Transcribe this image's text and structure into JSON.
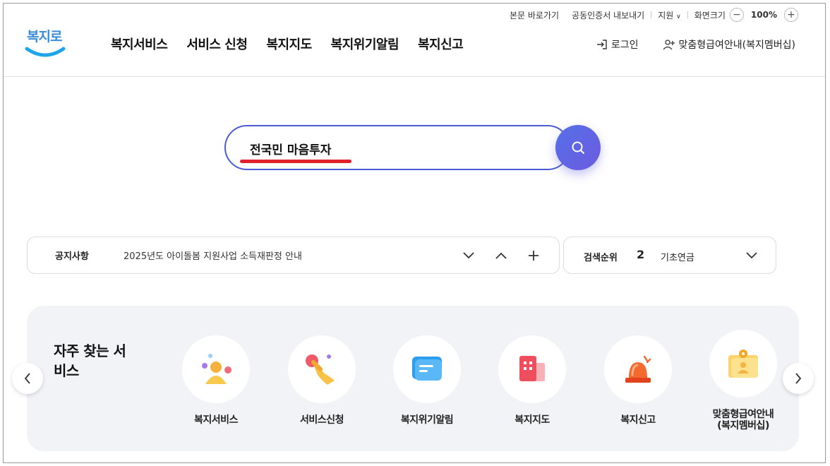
{
  "util": {
    "skip_to_content": "본문 바로가기",
    "cert_export": "공동인증서 내보내기",
    "support": "지원",
    "zoom_label": "화면크기",
    "zoom_value": "100%"
  },
  "header": {
    "logo_text": "복지로",
    "nav": [
      "복지서비스",
      "서비스 신청",
      "복지지도",
      "복지위기알림",
      "복지신고"
    ],
    "login": "로그인",
    "membership": "맞춤형급여안내(복지멤버십)"
  },
  "search": {
    "value": "전국민 마음투자"
  },
  "notice": {
    "label": "공지사항",
    "text": "2025년도 아이돌봄 지원사업 소득재판정 안내"
  },
  "rank": {
    "label": "검색순위",
    "number": "2",
    "text": "기초연금"
  },
  "frequent": {
    "title": "자주 찾는 서비스",
    "services": [
      {
        "label": "복지서비스",
        "icon": "person-icon"
      },
      {
        "label": "서비스신청",
        "icon": "hand-tap-icon"
      },
      {
        "label": "복지위기알림",
        "icon": "message-icon"
      },
      {
        "label": "복지지도",
        "icon": "building-icon"
      },
      {
        "label": "복지신고",
        "icon": "siren-icon"
      },
      {
        "label": "맞춤형급여안내\n(복지멤버십)",
        "icon": "badge-icon"
      }
    ]
  },
  "colors": {
    "accent": "#4b5bd6",
    "underline": "#e0202a",
    "logo": "#3a8bd8"
  }
}
